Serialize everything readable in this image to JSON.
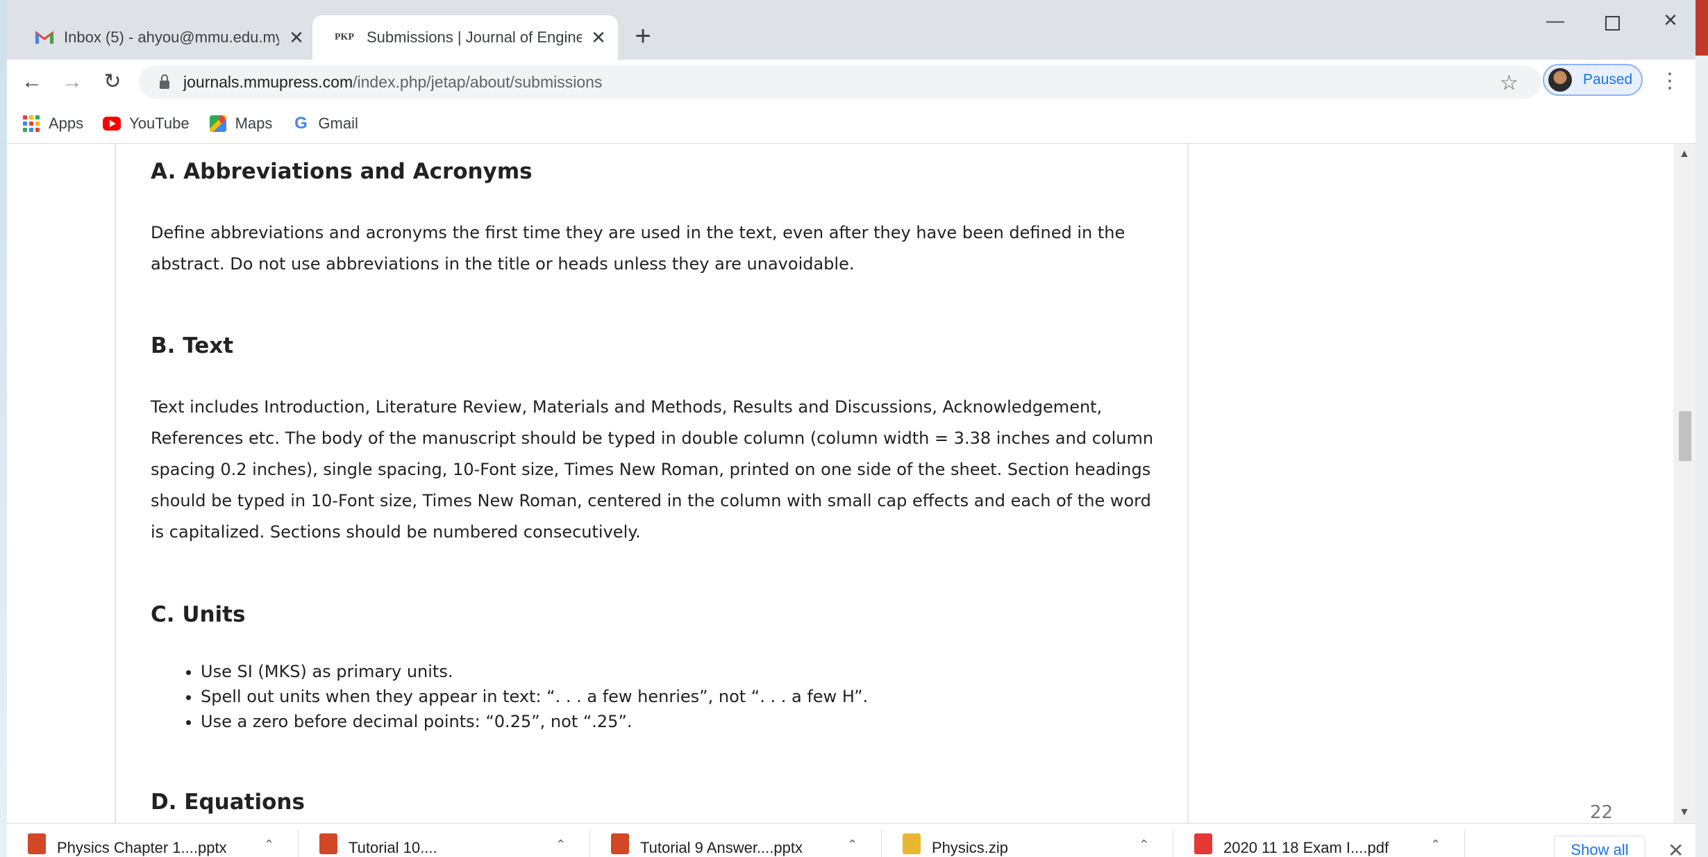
{
  "tabs": [
    {
      "title": "Inbox (5) - ahyou@mmu.edu.my",
      "favicon": "gmail-icon",
      "active": false
    },
    {
      "title": "Submissions | Journal of Engineering",
      "favicon": "pkp-icon",
      "favicon_text": "PKP",
      "active": true
    }
  ],
  "toolbar": {
    "url_host": "journals.mmupress.com",
    "url_path": "/index.php/jetap/about/submissions",
    "profile_label": "Paused"
  },
  "bookmarks": [
    {
      "label": "Apps",
      "icon": "apps-grid-icon"
    },
    {
      "label": "YouTube",
      "icon": "youtube-icon"
    },
    {
      "label": "Maps",
      "icon": "maps-icon"
    },
    {
      "label": "Gmail",
      "icon": "google-icon"
    }
  ],
  "article": {
    "sec_a": {
      "heading": "A. Abbreviations and Acronyms",
      "body": "Define abbreviations and acronyms the first time they are used in the text, even after they have been defined in the abstract. Do not use abbreviations in the title or heads unless they are unavoidable."
    },
    "sec_b": {
      "heading": "B. Text",
      "body": "Text includes Introduction, Literature Review, Materials and Methods, Results and Discussions, Acknowledgement, References etc. The body of the manuscript should be typed in double column (column width = 3.38 inches and column spacing 0.2 inches), single spacing, 10-Font size, Times New Roman, printed on one side of the sheet. Section headings should be typed in 10-Font size, Times New Roman, centered in the column with small cap effects and each of the word is capitalized. Sections should be numbered consecutively."
    },
    "sec_c": {
      "heading": "C. Units",
      "items": [
        "Use SI (MKS) as primary units.",
        "Spell out units when they appear in text: “. . . a few henries”, not “. . . a few H”.",
        "Use a zero before decimal points: “0.25”, not “.25”."
      ]
    },
    "sec_d": {
      "heading": "D. Equations"
    }
  },
  "slide_page_number": "22",
  "downloads": [
    {
      "name": "Physics Chapter 1....pptx",
      "color": "#d24726"
    },
    {
      "name": "Tutorial 10....",
      "color": "#d24726"
    },
    {
      "name": "Tutorial 9 Answer....pptx",
      "color": "#d24726"
    },
    {
      "name": "Physics.zip",
      "color": "#e8b730"
    },
    {
      "name": "2020 11 18 Exam I....pdf",
      "color": "#e53935"
    }
  ],
  "download_bar": {
    "show_all_label": "Show all"
  }
}
